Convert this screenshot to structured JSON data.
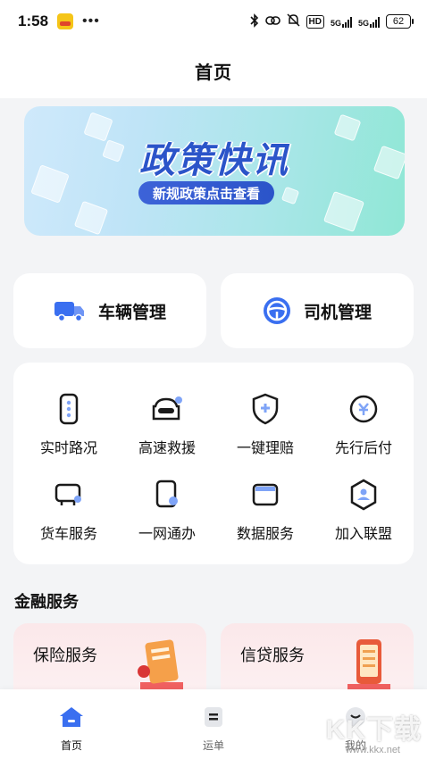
{
  "status": {
    "time": "1:58",
    "dots": "•••",
    "hd": "HD",
    "signal1": "5G",
    "signal2": "5G",
    "battery": "62"
  },
  "header": {
    "title": "首页"
  },
  "banner": {
    "title": "政策快讯",
    "subtitle": "新规政策点击查看"
  },
  "management": [
    {
      "label": "车辆管理",
      "icon": "truck-icon",
      "color": "#3a6ff0"
    },
    {
      "label": "司机管理",
      "icon": "steering-wheel-icon",
      "color": "#3a6ff0"
    }
  ],
  "services": [
    {
      "label": "实时路况",
      "icon": "traffic-light-icon"
    },
    {
      "label": "高速救援",
      "icon": "rescue-car-icon"
    },
    {
      "label": "一键理赔",
      "icon": "shield-plus-icon"
    },
    {
      "label": "先行后付",
      "icon": "pay-badge-icon"
    },
    {
      "label": "货车服务",
      "icon": "tv-monitor-icon"
    },
    {
      "label": "一网通办",
      "icon": "phone-card-icon"
    },
    {
      "label": "数据服务",
      "icon": "window-icon"
    },
    {
      "label": "加入联盟",
      "icon": "hexagon-user-icon"
    }
  ],
  "finance": {
    "title": "金融服务",
    "cards": [
      {
        "label": "保险服务",
        "icon": "insurance-illustration"
      },
      {
        "label": "信贷服务",
        "icon": "loan-illustration"
      }
    ]
  },
  "tabbar": [
    {
      "label": "首页",
      "icon": "home-icon",
      "active": true
    },
    {
      "label": "运单",
      "icon": "waybill-icon",
      "active": false
    },
    {
      "label": "我的",
      "icon": "profile-icon",
      "active": false
    }
  ],
  "watermark": {
    "text": "KK下载",
    "sub": "www.kkx.net"
  },
  "colors": {
    "accent": "#3a6ff0",
    "brandDark": "#2b54c9",
    "icon": "#1a1a1a"
  }
}
